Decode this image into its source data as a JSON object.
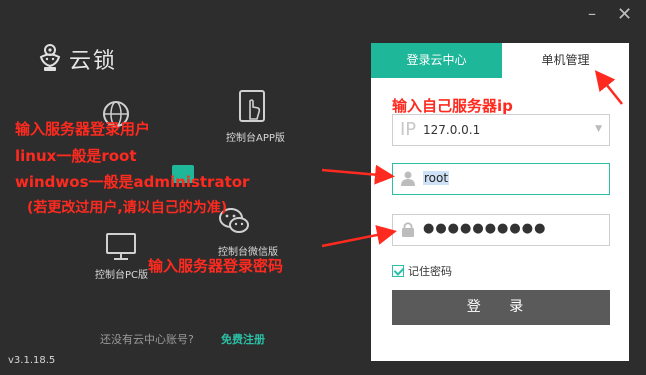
{
  "window": {
    "minimize_glyph": "–",
    "close_glyph": "✕"
  },
  "brand": {
    "name": "云锁"
  },
  "left_panel": {
    "items": [
      {
        "label": "控制台APP版",
        "icon": "tablet-icon"
      },
      {
        "label": "控制台微信版",
        "icon": "wechat-icon"
      },
      {
        "label": "控制台PC版",
        "icon": "monitor-icon"
      }
    ],
    "no_account_text": "还没有云中心账号?",
    "register_link": "免费注册",
    "version": "v3.1.18.5"
  },
  "login": {
    "tabs": [
      {
        "label": "登录云中心"
      },
      {
        "label": "单机管理"
      }
    ],
    "ip_prefix": "IP",
    "ip_value": "127.0.0.1",
    "username_value": "root",
    "password_masked": "●●●●●●●●●●",
    "remember_label": "记住密码",
    "login_button": "登 录"
  },
  "annotations": {
    "ip_note": "输入自己服务器ip",
    "user_note_1": "输入服务器登录用户",
    "user_note_2": "linux一般是root",
    "user_note_3": "windwos一般是administrator",
    "user_note_4": "(若更改过用户,请以自己的为准)",
    "password_note": "输入服务器登录密码"
  },
  "colors": {
    "accent": "#1fb79a",
    "annotation": "#ff2a1f",
    "background": "#2d2d2d",
    "button": "#5a5a5a"
  }
}
